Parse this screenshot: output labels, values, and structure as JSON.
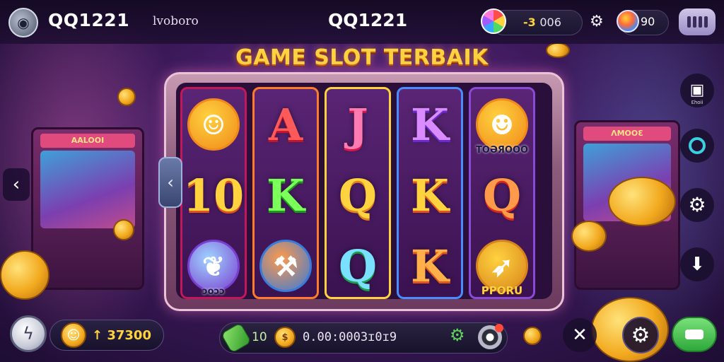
{
  "header": {
    "brand_left": "QQ1221",
    "tagline": "lvoboro",
    "brand_center": "QQ1221",
    "balance_amount": "-3",
    "balance_suffix": "006",
    "level": "90"
  },
  "title": "GAME SLOT TERBAIK",
  "reels": [
    {
      "border": "#c2185b",
      "symbols": [
        {
          "kind": "emblem",
          "icon": "sun-face-icon",
          "glyph": "☺",
          "colors": [
            "#ffd23f",
            "#f08a1a"
          ]
        },
        {
          "kind": "text",
          "text": "10",
          "colors": [
            "#ffd23f",
            "#e2541a"
          ]
        },
        {
          "kind": "emblem",
          "icon": "fruit-badge-icon",
          "glyph": "❦",
          "colors": [
            "#9fd4ff",
            "#7a3fd0"
          ],
          "label": "ɔoɔɔ"
        }
      ]
    },
    {
      "border": "#ff7a2a",
      "symbols": [
        {
          "kind": "text",
          "text": "A",
          "colors": [
            "#ff5a5a",
            "#c0152a"
          ]
        },
        {
          "kind": "text",
          "text": "K",
          "colors": [
            "#7bff5a",
            "#1e9a1a"
          ]
        },
        {
          "kind": "emblem",
          "icon": "magic-wand-icon",
          "glyph": "⚒",
          "colors": [
            "#ff9a4a",
            "#3a7ad8"
          ]
        }
      ]
    },
    {
      "border": "#ffd23f",
      "symbols": [
        {
          "kind": "text",
          "text": "J",
          "colors": [
            "#ff7ab0",
            "#d8184a"
          ]
        },
        {
          "kind": "text",
          "text": "Q",
          "colors": [
            "#ffd23f",
            "#e2841a"
          ]
        },
        {
          "kind": "text",
          "text": "Q",
          "colors": [
            "#7ae0ff",
            "#1aa04a"
          ]
        }
      ]
    },
    {
      "border": "#4a8cff",
      "symbols": [
        {
          "kind": "text",
          "text": "K",
          "colors": [
            "#d98bff",
            "#6a2ad0"
          ]
        },
        {
          "kind": "text",
          "text": "K",
          "colors": [
            "#ffd23f",
            "#e2541a"
          ]
        },
        {
          "kind": "text",
          "text": "K",
          "colors": [
            "#ffb04a",
            "#e2541a"
          ]
        }
      ]
    },
    {
      "border": "#8a4ad8",
      "symbols": [
        {
          "kind": "emblem",
          "icon": "jackpot-emblem-icon",
          "glyph": "☻",
          "colors": [
            "#ffd23f",
            "#f08a1a"
          ],
          "label": "TOƏЯOOO"
        },
        {
          "kind": "text",
          "text": "Q",
          "colors": [
            "#ff9a4a",
            "#d8281a"
          ]
        },
        {
          "kind": "emblem",
          "icon": "gold-horn-icon",
          "glyph": "➶",
          "colors": [
            "#ffd23f",
            "#d8841a"
          ],
          "label": "PPORU",
          "label_style": "gold"
        }
      ]
    }
  ],
  "bottom": {
    "win_amount": "37300",
    "bet": "10",
    "credits": "0.00:0003ɪ0ɪ9"
  },
  "side": {
    "camera_caption": "Ɛhoii"
  }
}
